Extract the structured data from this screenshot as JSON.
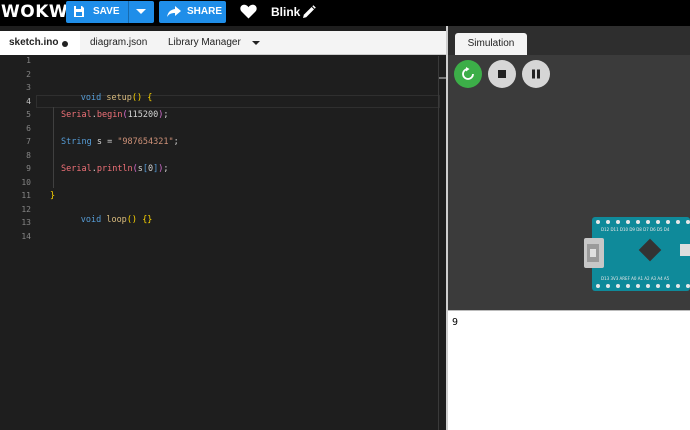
{
  "header": {
    "logo": "WOKWi",
    "save_label": "SAVE",
    "share_label": "SHARE",
    "project_name": "Blink",
    "icons": [
      "save-icon",
      "caret-down-icon",
      "share-icon",
      "heart-icon",
      "pencil-icon"
    ]
  },
  "editor": {
    "tabs": [
      {
        "label": "sketch.ino",
        "active": true,
        "unsaved": true
      },
      {
        "label": "diagram.json",
        "active": false
      },
      {
        "label": "Library Manager",
        "active": false
      }
    ],
    "line_numbers": [
      "1",
      "2",
      "3",
      "4",
      "5",
      "6",
      "7",
      "8",
      "9",
      "10",
      "11",
      "12",
      "13",
      "14"
    ],
    "current_line": 4,
    "code": {
      "l3": {
        "kw": "void",
        "fn": "setup",
        "open": "()",
        "brace": "{"
      },
      "l5": {
        "obj": "Serial",
        "dot": ".",
        "method": "begin",
        "lp": "(",
        "num": "115200",
        "rp": ")",
        "end": ";"
      },
      "l7": {
        "type": "String",
        "rest": " s = ",
        "str": "\"987654321\"",
        "end": ";"
      },
      "l9": {
        "obj": "Serial",
        "dot": ".",
        "method": "println",
        "lp": "(",
        "var": "s",
        "lb": "[",
        "num": "0",
        "rb": "]",
        "rp": ")",
        "end": ";"
      },
      "l11": {
        "brace": "}"
      },
      "l12": {
        "kw": "void",
        "fn": "loop",
        "open": "()",
        "braces": "{}"
      }
    }
  },
  "simulation": {
    "tab_label": "Simulation",
    "controls": [
      "restart-icon",
      "stop-icon",
      "pause-icon"
    ],
    "board": {
      "top_pins": "D12 D11 D10 D9 D8 D7 D6 D5 D4",
      "bottom_pins": "D13 3V3 AREF A0 A1 A2 A3 A4 A5"
    },
    "serial_output": "9"
  },
  "colors": {
    "accent": "#1f8ee9",
    "run": "#3cae48",
    "board": "#0f8a9a"
  }
}
